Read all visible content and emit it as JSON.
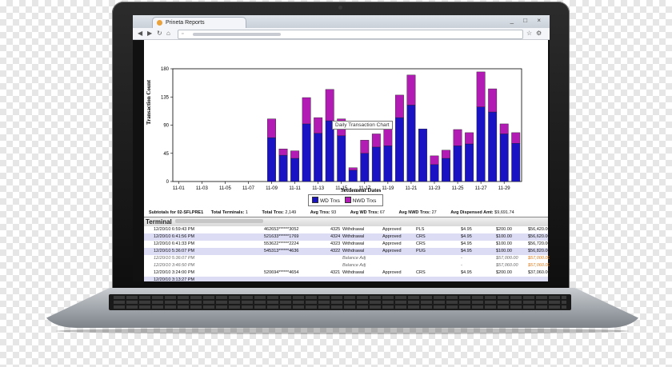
{
  "browser": {
    "tab_title": "Prineta Reports",
    "window_controls": "_ □ ×"
  },
  "chart_data": {
    "type": "bar",
    "stacked": true,
    "xlabel": "Settlement Dates",
    "ylabel": "Transaction Count",
    "ylim": [
      0,
      180
    ],
    "yticks": [
      0,
      45,
      90,
      135,
      180
    ],
    "categories": [
      "11-01",
      "11-02",
      "11-03",
      "11-04",
      "11-05",
      "11-06",
      "11-07",
      "11-08",
      "11-09",
      "11-10",
      "11-11",
      "11-12",
      "11-13",
      "11-14",
      "11-15",
      "11-16",
      "11-17",
      "11-18",
      "11-19",
      "11-20",
      "11-21",
      "11-22",
      "11-23",
      "11-24",
      "11-25",
      "11-26",
      "11-27",
      "11-28",
      "11-29",
      "11-30"
    ],
    "xtick_labels": [
      "11-01",
      "11-03",
      "11-05",
      "11-07",
      "11-09",
      "11-11",
      "11-13",
      "11-15",
      "11-17",
      "11-19",
      "11-21",
      "11-23",
      "11-25",
      "11-27",
      "11-29"
    ],
    "series": [
      {
        "name": "WD Trxs",
        "color": "#1a13c4",
        "values": [
          0,
          0,
          0,
          0,
          0,
          0,
          0,
          0,
          70,
          42,
          37,
          92,
          77,
          97,
          73,
          18,
          45,
          55,
          57,
          102,
          122,
          84,
          27,
          37,
          57,
          60,
          119,
          111,
          76,
          61
        ]
      },
      {
        "name": "NWD Trxs",
        "color": "#b21cb5",
        "values": [
          0,
          0,
          0,
          0,
          0,
          0,
          0,
          0,
          30,
          10,
          12,
          42,
          25,
          50,
          27,
          4,
          21,
          21,
          30,
          36,
          48,
          0,
          14,
          13,
          26,
          18,
          56,
          37,
          16,
          17
        ]
      }
    ],
    "tooltip": "Daily Transaction Chart",
    "grid": false,
    "legend": "bottom-center"
  },
  "report": {
    "subtotal": {
      "title": "Subtotals for 02-SFLPRE1",
      "items": [
        {
          "label": "Total Terminals:",
          "value": "1"
        },
        {
          "label": "Total Trxs:",
          "value": "2,149"
        },
        {
          "label": "Avg Trxs:",
          "value": "93"
        },
        {
          "label": "Avg WD Trxs:",
          "value": "67"
        },
        {
          "label": "Avg NWD Trxs:",
          "value": "27"
        },
        {
          "label": "Avg Dispensed Amt:",
          "value": "$9,691.74"
        }
      ]
    },
    "terminal_label": "Terminal",
    "rows": [
      {
        "date": "12/20/10 6:59:43 PM",
        "card": "462653******3052",
        "id": "4325",
        "type": "Withdrawal",
        "status": "Approved",
        "term": "PLS",
        "fee": "$4.95",
        "amt": "$200.00",
        "bal": "$56,420.00",
        "alt": false,
        "adj": false
      },
      {
        "date": "12/20/10 6:41:56 PM",
        "card": "521633******1769",
        "id": "4324",
        "type": "Withdrawal",
        "status": "Approved",
        "term": "CRS",
        "fee": "$4.95",
        "amt": "$100.00",
        "bal": "$56,620.00",
        "alt": true,
        "adj": false
      },
      {
        "date": "12/20/10 6:41:33 PM",
        "card": "553622******2224",
        "id": "4323",
        "type": "Withdrawal",
        "status": "Approved",
        "term": "CRS",
        "fee": "$4.95",
        "amt": "$100.00",
        "bal": "$56,720.00",
        "alt": false,
        "adj": false
      },
      {
        "date": "12/20/10 5:36:07 PM",
        "card": "545313******4636",
        "id": "4322",
        "type": "Withdrawal",
        "status": "Approved",
        "term": "PUG",
        "fee": "$4.95",
        "amt": "$100.00",
        "bal": "$56,820.00",
        "alt": true,
        "adj": false
      },
      {
        "date": "12/20/10 5:36:07 PM",
        "card": "",
        "id": "",
        "type": "Balance Adj",
        "status": "",
        "term": "",
        "fee": "-",
        "amt": "$57,000.00",
        "bal": "$57,000.00",
        "alt": false,
        "adj": true
      },
      {
        "date": "12/20/10 3:46:50 PM",
        "card": "",
        "id": "",
        "type": "Balance Adj",
        "status": "",
        "term": "",
        "fee": "-",
        "amt": "$57,060.00",
        "bal": "$57,060.00",
        "alt": false,
        "adj": true
      },
      {
        "date": "12/20/10 3:24:00 PM",
        "card": "520694******4654",
        "id": "4321",
        "type": "Withdrawal",
        "status": "Approved",
        "term": "CRS",
        "fee": "$4.95",
        "amt": "$200.00",
        "bal": "$37,060.00",
        "alt": false,
        "adj": false
      },
      {
        "date": "12/20/10 3:13:27 PM",
        "card": "",
        "id": "",
        "type": "",
        "status": "",
        "term": "",
        "fee": "",
        "amt": "",
        "bal": "",
        "alt": true,
        "adj": false
      }
    ]
  }
}
